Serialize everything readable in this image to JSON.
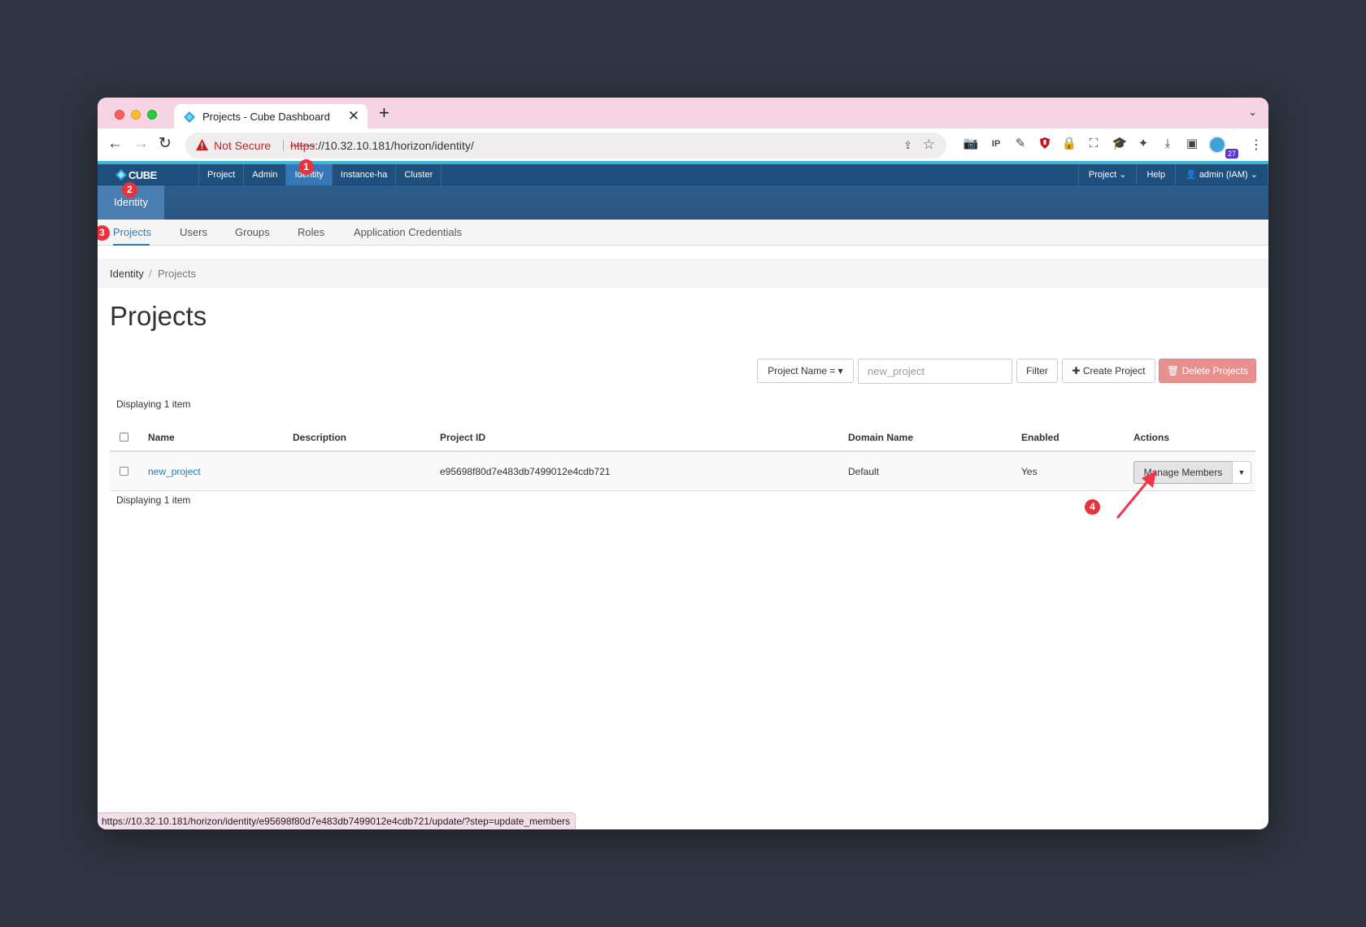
{
  "browser": {
    "tab_title": "Projects - Cube Dashboard",
    "new_tab": "+",
    "close": "✕",
    "tab_menu": "⌄",
    "security_label": "Not Secure",
    "url_scheme": "https",
    "url_rest": "://10.32.10.181/horizon/identity/",
    "extension_badge": "27",
    "status_url": "https://10.32.10.181/horizon/identity/e95698f80d7e483db7499012e4cdb721/update/?step=update_members"
  },
  "navbar": {
    "brand": "CUBE",
    "menu": [
      "Project",
      "Admin",
      "Identity",
      "Instance-ha",
      "Cluster"
    ],
    "active_menu": "Identity",
    "right": {
      "project": "Project ⌄",
      "help": "Help",
      "user": "👤 admin (IAM) ⌄"
    }
  },
  "panel": {
    "tab": "Identity"
  },
  "subnav": [
    "Projects",
    "Users",
    "Groups",
    "Roles",
    "Application Credentials"
  ],
  "breadcrumb": {
    "parent": "Identity",
    "separator": "/",
    "current": "Projects"
  },
  "page_title": "Projects",
  "filter": {
    "field_label": "Project Name = ▾",
    "input_value": "new_project",
    "filter_button": "Filter",
    "create_button": "✚ Create Project",
    "delete_button": "🗑 Delete Projects"
  },
  "table": {
    "count_top": "Displaying 1 item",
    "count_bottom": "Displaying 1 item",
    "columns": [
      "Name",
      "Description",
      "Project ID",
      "Domain Name",
      "Enabled",
      "Actions"
    ],
    "rows": [
      {
        "name": "new_project",
        "description": "",
        "project_id": "e95698f80d7e483db7499012e4cdb721",
        "domain": "Default",
        "enabled": "Yes",
        "action": "Manage Members"
      }
    ]
  },
  "annotations": [
    "1",
    "2",
    "3",
    "4"
  ],
  "colors": {
    "navbar": "#1f4f7c",
    "active_menu": "#3577b7",
    "link": "#2a7ab8",
    "danger": "#e8908e",
    "marker": "#e8333c",
    "tabstrip": "#f6d4e3"
  }
}
